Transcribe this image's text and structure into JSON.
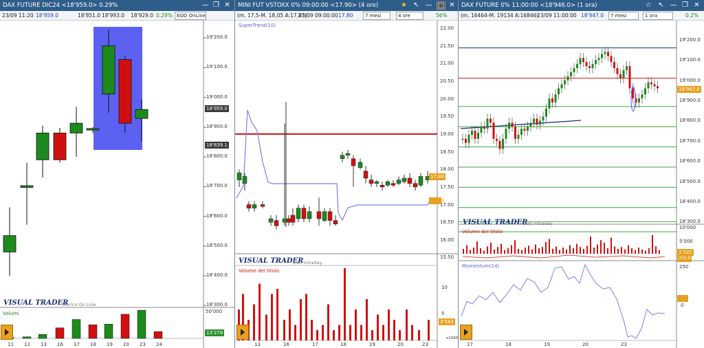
{
  "w1": {
    "title": "DAX FUTURE DIC24 <18'959.0> 0.29%",
    "info_time": "23/09 11:20",
    "info_v1": "18'959.0",
    "info_v2": "18'851.0",
    "info_v3": "18'993.0",
    "info_v4": "18'929.0",
    "info_pct": "0.29%",
    "mode": "EOD OnLine",
    "price_ticks": [
      "19'200.0",
      "19'100.0",
      "19'000.0",
      "18'900.0",
      "18'800.0",
      "18'700.0",
      "18'600.0",
      "18'500.0",
      "18'400.0",
      "18'300.0"
    ],
    "last_price": "18'959.0",
    "box_low": "18'839.1",
    "vt_title": "VISUAL TRADER",
    "vt_sub": "Storico On Line",
    "volume_label": "Volumi",
    "volume_tick": "50'000",
    "volume_last": "13'279",
    "x_ticks": [
      "11",
      "12",
      "13",
      "16",
      "17",
      "18",
      "19",
      "20",
      "23",
      "24"
    ],
    "candles": [
      {
        "o": 18480,
        "h": 18630,
        "l": 18400,
        "c": 18535
      },
      {
        "o": 18697,
        "h": 18780,
        "l": 18572,
        "c": 18703
      },
      {
        "o": 18790,
        "h": 18905,
        "l": 18730,
        "c": 18880
      },
      {
        "o": 18880,
        "h": 18897,
        "l": 18780,
        "c": 18790
      },
      {
        "o": 18880,
        "h": 18968,
        "l": 18800,
        "c": 18913
      },
      {
        "o": 18890,
        "h": 18900,
        "l": 18880,
        "c": 18895
      },
      {
        "o": 19011,
        "h": 19227,
        "l": 18948,
        "c": 19173
      },
      {
        "o": 19127,
        "h": 19140,
        "l": 18880,
        "c": 18913
      },
      {
        "o": 18929,
        "h": 18993,
        "l": 18851,
        "c": 18959
      }
    ],
    "volumes": [
      1500,
      2500,
      6500,
      17000,
      30500,
      22000,
      23000,
      39000,
      45500,
      11000
    ],
    "colors": {
      "up": "#1c8a1c",
      "down": "#d01010",
      "selection": "#4a50f0"
    }
  },
  "w2": {
    "title": "MINI FUT VSTOXX 0% 09:00:00 <17.90> (4 ore)",
    "info_ohlc": "(m. 17,5-M. 18,05 A:17,85)",
    "info_time": "23/09 09:00:00",
    "info_price": "17.80",
    "period": "7 mesi",
    "timeframe": "4 ore",
    "pct": "56%",
    "indicator": "SuperTrend(10)",
    "price_ticks": [
      "22.00",
      "21.50",
      "21.00",
      "20.50",
      "20.00",
      "19.50",
      "19.00",
      "18.50",
      "18.00",
      "17.50",
      "17.00",
      "16.50",
      "16.00",
      "15.50"
    ],
    "last_price": "17.80",
    "trend_price": "16.93",
    "vt_title": "VISUAL TRADER",
    "vt_sub": "Dati Intraday",
    "volume_label": "Volume del titolo",
    "vol_ticks": [
      "10",
      "5"
    ],
    "vol_last": "3'563",
    "vol_unit": "x1000",
    "x_ticks": [
      "13",
      "16",
      "17",
      "18",
      "19",
      "20",
      "23"
    ]
  },
  "w3": {
    "title": "DAX FUTURE 0% 11:00:00 <18'946.0> (1 ora)",
    "info_ohlc": "(m. 16464-M. 19134 A:16846)",
    "info_time": "23/09 11:00:00",
    "info_price": "18'947.0",
    "period": "7 mesi",
    "timeframe": "1 ora",
    "pct": "0.2%",
    "price_ticks": [
      "19'200.0",
      "19'100.0",
      "19'000.0",
      "18'900.0",
      "18'800.0",
      "18'700.0",
      "18'600.0",
      "18'500.0",
      "18'400.0",
      "18'300.0"
    ],
    "last_price": "18'947.0",
    "vt_title": "VISUAL TRADER",
    "vt_sub": "Dati Intraday",
    "volume_label": "Volume del titolo",
    "vol_ticks": [
      "10'000",
      "5'000"
    ],
    "vol_last": "1'322",
    "vol_osc": "335.9",
    "momentum_label": "Momentum(14)",
    "mom_ticks": [
      "250",
      "0"
    ],
    "x_ticks": [
      "17",
      "18",
      "19",
      "20",
      "23"
    ]
  }
}
